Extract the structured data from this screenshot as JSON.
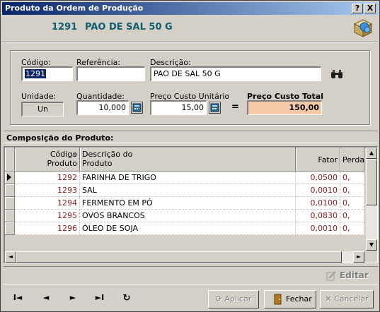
{
  "window": {
    "title": "Produto da Ordem de Produção",
    "help_button": "?",
    "close_button": "X"
  },
  "header": {
    "code": "1291",
    "name": "PAO DE SAL 50 G"
  },
  "form": {
    "codigo_label": "Código:",
    "codigo_value": "1291",
    "referencia_label": "Referência:",
    "referencia_value": "",
    "descricao_label": "Descrição:",
    "descricao_value": "PAO DE SAL 50 G",
    "unidade_label": "Unidade:",
    "unidade_value": "Un",
    "quantidade_label": "Quantidade:",
    "quantidade_value": "10,000",
    "preco_unit_label": "Preço Custo Unitário",
    "preco_unit_value": "15,00",
    "equals": "=",
    "preco_total_label": "Preço Custo Total",
    "preco_total_value": "150,00"
  },
  "composition": {
    "title": "Composição do Produto:",
    "columns": {
      "codigo_l1": "Código",
      "codigo_l2": "Produto",
      "descricao_l1": "Descrição do",
      "descricao_l2": "Produto",
      "fator": "Fator",
      "perda": "Perda"
    },
    "rows": [
      {
        "code": "1292",
        "desc": "FARINHA DE TRIGO",
        "fator": "0,0500",
        "perda": "0,"
      },
      {
        "code": "1293",
        "desc": "SAL",
        "fator": "0,0010",
        "perda": "0,"
      },
      {
        "code": "1294",
        "desc": "FERMENTO EM PÓ",
        "fator": "0,0100",
        "perda": "0,"
      },
      {
        "code": "1295",
        "desc": "OVOS BRANCOS",
        "fator": "0,0830",
        "perda": "0,"
      },
      {
        "code": "1296",
        "desc": "ÓLEO DE SOJA",
        "fator": "0,0010",
        "perda": "0,"
      }
    ]
  },
  "actions": {
    "editar": "Editar",
    "aplicar": "Aplicar",
    "fechar": "Fechar",
    "cancelar": "Cancelar",
    "nav_first": "I◄",
    "nav_prev": "◄",
    "nav_next": "►",
    "nav_last": "►I",
    "nav_refresh": "↻"
  },
  "colors": {
    "title_blue": "#0a246a",
    "header_teal": "#0f5f6f",
    "total_bg": "#f5c9a8",
    "code_red": "#8b1a1a"
  }
}
